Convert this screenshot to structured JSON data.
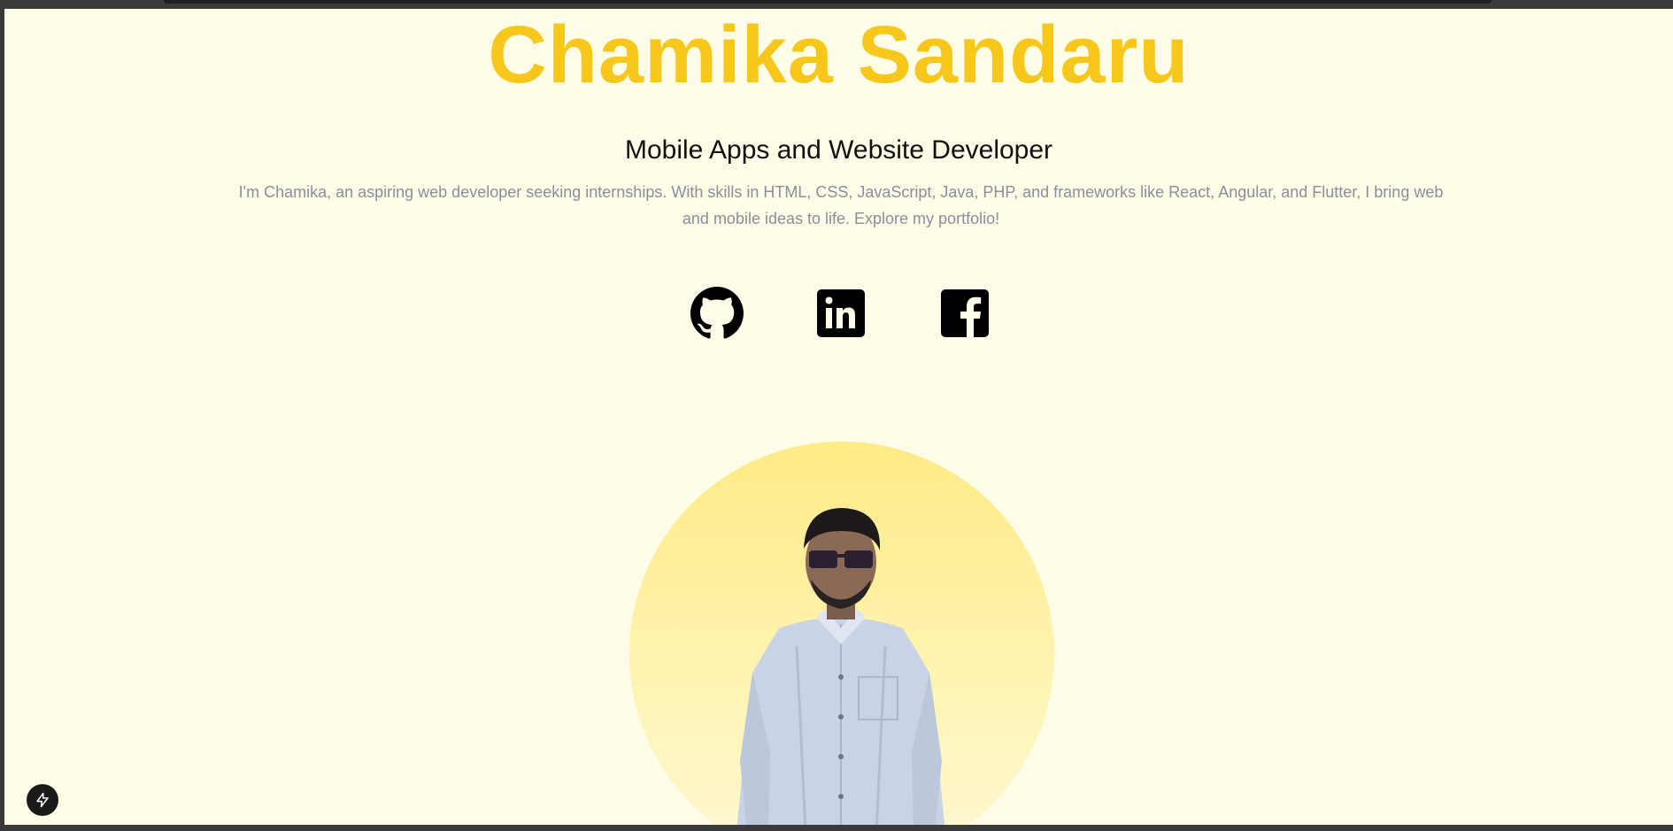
{
  "hero": {
    "name": "Chamika Sandaru",
    "subtitle": "Mobile Apps and Website Developer",
    "intro": "I'm Chamika, an aspiring web developer seeking internships. With skills in HTML, CSS, JavaScript, Java, PHP, and frameworks like React, Angular, and Flutter, I bring web and mobile ideas to life. Explore my portfolio!"
  },
  "social_links": [
    {
      "icon": "github-icon"
    },
    {
      "icon": "linkedin-icon"
    },
    {
      "icon": "facebook-icon"
    }
  ],
  "colors": {
    "accent": "#f8c71b",
    "background": "#fffce8",
    "muted_text": "#8a8f9c"
  },
  "floating_button": {
    "icon": "lightning-bolt-icon"
  }
}
